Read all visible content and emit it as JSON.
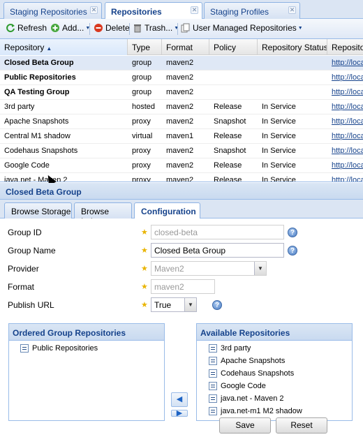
{
  "top_tabs": [
    {
      "label": "Staging Repositories",
      "active": false
    },
    {
      "label": "Repositories",
      "active": true
    },
    {
      "label": "Staging Profiles",
      "active": false
    }
  ],
  "toolbar": {
    "refresh": "Refresh",
    "add": "Add...",
    "delete": "Delete",
    "trash": "Trash...",
    "user_managed": "User Managed Repositories"
  },
  "grid": {
    "columns": [
      "Repository",
      "Type",
      "Format",
      "Policy",
      "Repository Status",
      "Repositor"
    ],
    "rows": [
      {
        "name": "Closed Beta Group",
        "type": "group",
        "format": "maven2",
        "policy": "",
        "status": "",
        "url": "http://loca",
        "bold": true,
        "selected": true
      },
      {
        "name": "Public Repositories",
        "type": "group",
        "format": "maven2",
        "policy": "",
        "status": "",
        "url": "http://loca",
        "bold": true
      },
      {
        "name": "QA Testing Group",
        "type": "group",
        "format": "maven2",
        "policy": "",
        "status": "",
        "url": "http://loca",
        "bold": true
      },
      {
        "name": "3rd party",
        "type": "hosted",
        "format": "maven2",
        "policy": "Release",
        "status": "In Service",
        "url": "http://loca"
      },
      {
        "name": "Apache Snapshots",
        "type": "proxy",
        "format": "maven2",
        "policy": "Snapshot",
        "status": "In Service",
        "url": "http://loca"
      },
      {
        "name": "Central M1 shadow",
        "type": "virtual",
        "format": "maven1",
        "policy": "Release",
        "status": "In Service",
        "url": "http://loca"
      },
      {
        "name": "Codehaus Snapshots",
        "type": "proxy",
        "format": "maven2",
        "policy": "Snapshot",
        "status": "In Service",
        "url": "http://loca"
      },
      {
        "name": "Google Code",
        "type": "proxy",
        "format": "maven2",
        "policy": "Release",
        "status": "In Service",
        "url": "http://loca"
      },
      {
        "name": "java.net - Maven 2",
        "type": "proxy",
        "format": "maven2",
        "policy": "Release",
        "status": "In Service",
        "url": "http://loca"
      }
    ]
  },
  "detail": {
    "title": "Closed Beta Group",
    "tabs": [
      {
        "label": "Browse Storage",
        "active": false
      },
      {
        "label": "Browse Index",
        "active": false
      },
      {
        "label": "Configuration",
        "active": true
      }
    ],
    "form": {
      "group_id": {
        "label": "Group ID",
        "value": "closed-beta"
      },
      "group_name": {
        "label": "Group Name",
        "value": "Closed Beta Group"
      },
      "provider": {
        "label": "Provider",
        "value": "Maven2"
      },
      "format": {
        "label": "Format",
        "value": "maven2"
      },
      "publish_url": {
        "label": "Publish URL",
        "value": "True"
      }
    },
    "ordered": {
      "title": "Ordered Group Repositories",
      "items": [
        "Public Repositories"
      ]
    },
    "available": {
      "title": "Available Repositories",
      "items": [
        "3rd party",
        "Apache Snapshots",
        "Codehaus Snapshots",
        "Google Code",
        "java.net - Maven 2",
        "java.net-m1 M2 shadow"
      ]
    },
    "buttons": {
      "save": "Save",
      "reset": "Reset"
    }
  }
}
